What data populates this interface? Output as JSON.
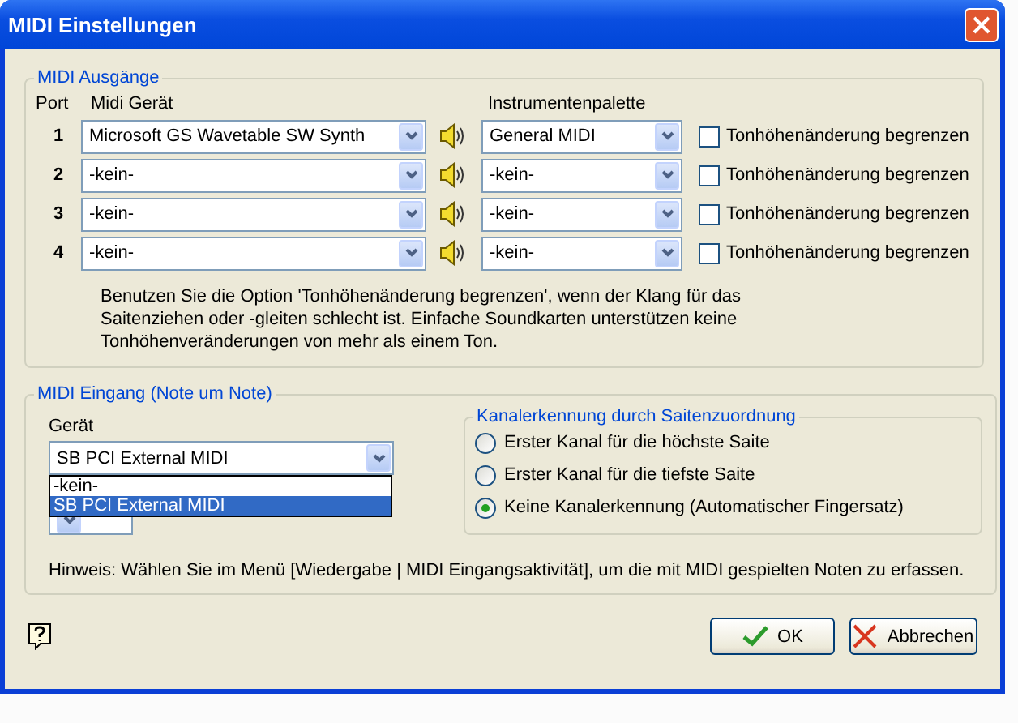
{
  "window": {
    "title": "MIDI Einstellungen"
  },
  "outputs": {
    "title": "MIDI Ausgänge",
    "headers": {
      "port": "Port",
      "device": "Midi Gerät",
      "palette": "Instrumentenpalette"
    },
    "rows": [
      {
        "port": "1",
        "device": "Microsoft GS Wavetable SW Synth",
        "palette": "General MIDI",
        "limit_label": "Tonhöhenänderung begrenzen",
        "checked": false
      },
      {
        "port": "2",
        "device": "-kein-",
        "palette": "-kein-",
        "limit_label": "Tonhöhenänderung begrenzen",
        "checked": false
      },
      {
        "port": "3",
        "device": "-kein-",
        "palette": "-kein-",
        "limit_label": "Tonhöhenänderung begrenzen",
        "checked": false
      },
      {
        "port": "4",
        "device": "-kein-",
        "palette": "-kein-",
        "limit_label": "Tonhöhenänderung begrenzen",
        "checked": false
      }
    ],
    "note": "Benutzen Sie die Option 'Tonhöhenänderung begrenzen', wenn der Klang für das Saitenziehen oder -gleiten schlecht ist. Einfache Soundkarten unterstützen keine Tonhöhenveränderungen von mehr als einem Ton."
  },
  "input": {
    "title": "MIDI Eingang (Note um Note)",
    "device_label": "Gerät",
    "device": "SB PCI External MIDI",
    "device_options": [
      {
        "label": "-kein-",
        "selected": false
      },
      {
        "label": "SB PCI External MIDI",
        "selected": true
      }
    ],
    "channel_group": {
      "title": "Kanalerkennung durch Saitenzuordnung",
      "options": [
        {
          "label": "Erster Kanal für die höchste Saite",
          "selected": false
        },
        {
          "label": "Erster Kanal für die tiefste Saite",
          "selected": false
        },
        {
          "label": "Keine Kanalerkennung (Automatischer Fingersatz)",
          "selected": true
        }
      ]
    },
    "hint": "Hinweis: Wählen Sie im Menü [Wiedergabe | MIDI Eingangsaktivität], um die mit MIDI gespielten Noten zu erfassen."
  },
  "buttons": [
    {
      "kind": "ok",
      "label": "OK"
    },
    {
      "kind": "cancel",
      "label": "Abbrechen"
    }
  ]
}
